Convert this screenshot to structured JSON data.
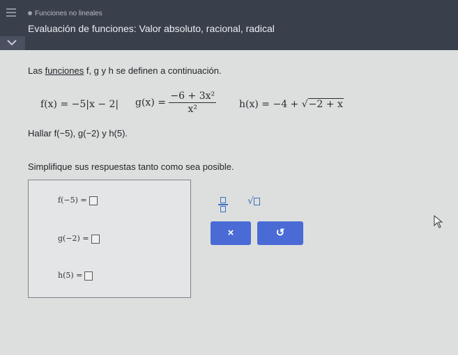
{
  "header": {
    "module": "Funciones no lineales",
    "title": "Evaluación de funciones: Valor absoluto, racional, radical"
  },
  "problem": {
    "intro_prefix": "Las ",
    "intro_link": "funciones",
    "intro_suffix": " f, g y h se definen a continuación.",
    "f_def": "f(x) = −5|x − 2|",
    "g_lhs": "g(x) =",
    "g_num": "−6 + 3x²",
    "g_den": "x²",
    "h_lhs": "h(x) = −4 + ",
    "h_rad": "−2 + x",
    "find": "Hallar f(−5), g(−2) y h(5).",
    "instruction": "Simplifique sus respuestas tanto como sea posible."
  },
  "answers": {
    "f": "f(−5) =",
    "g": "g(−2) =",
    "h": "h(5) ="
  },
  "tools": {
    "sqrt_symbol": "√",
    "clear": "×",
    "undo": "↺"
  },
  "colors": {
    "header_bg": "#3a3f4c",
    "tool_blue": "#3a6fbf",
    "button_blue": "#4a6bd6"
  }
}
